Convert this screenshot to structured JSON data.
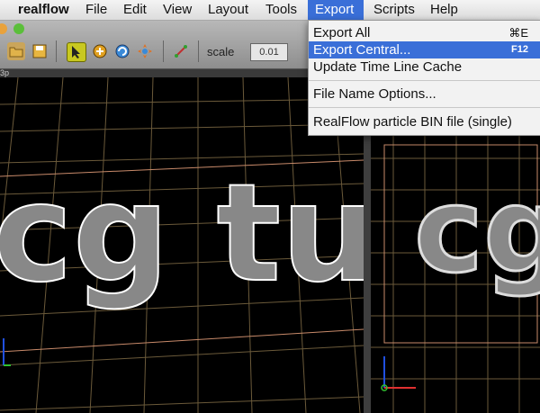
{
  "menubar": {
    "app": "realflow",
    "items": [
      "File",
      "Edit",
      "View",
      "Layout",
      "Tools",
      "Export",
      "Scripts",
      "Help"
    ],
    "active": "Export"
  },
  "toolbar": {
    "scale_label": "scale",
    "scale_value": "0.01"
  },
  "viewport_left": {
    "label": "3p"
  },
  "export_menu": {
    "items": [
      {
        "label": "Export All",
        "shortcut": "⌘E"
      },
      {
        "label": "Export Central...",
        "shortcut": "F12"
      },
      {
        "label": "Update Time Line Cache",
        "shortcut": ""
      },
      {
        "label": "File Name Options...",
        "shortcut": ""
      },
      {
        "label": "RealFlow particle BIN file (single)",
        "shortcut": ""
      }
    ],
    "highlighted": "Export Central..."
  },
  "scene": {
    "left_text": "cg tu",
    "right_text": "cg"
  },
  "colors": {
    "accent": "#3a6fd8",
    "grid": "#6b5a3a",
    "guide": "#c88a6a",
    "axis_x": "#e03030",
    "axis_y": "#2050e0",
    "axis_z": "#30c030"
  }
}
